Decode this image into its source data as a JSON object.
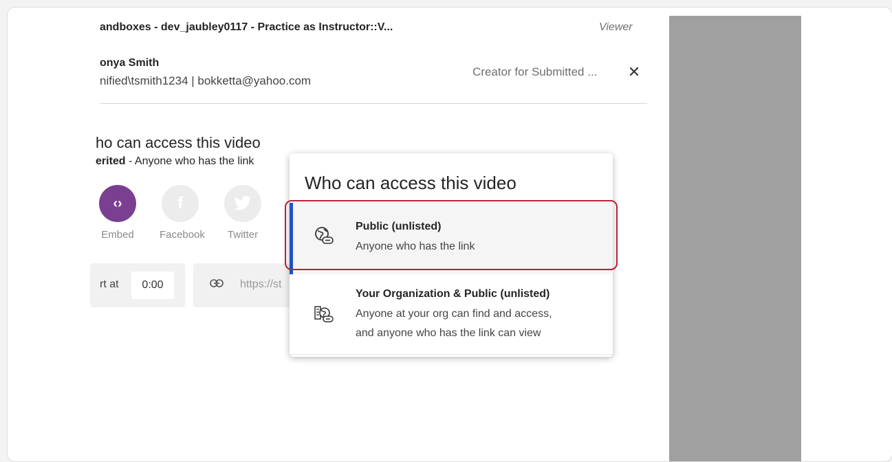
{
  "header": {
    "channel_title": "andboxes - dev_jaubley0117 - Practice as Instructor::V...",
    "role": "Viewer"
  },
  "user": {
    "name": "onya Smith",
    "details": "nified\\tsmith1234 | bokketta@yahoo.com",
    "role": "Creator for Submitted ..."
  },
  "access_section": {
    "heading": "ho can access this video",
    "status_bold": "erited",
    "status_rest": " - Anyone who has the link"
  },
  "share": {
    "items": [
      {
        "label": "Embed",
        "icon": "embed-icon"
      },
      {
        "label": "Facebook",
        "icon": "facebook-icon"
      },
      {
        "label": "Twitter",
        "icon": "twitter-icon"
      }
    ],
    "start_label": "rt at",
    "start_time": "0:00",
    "url": "https://st"
  },
  "dropdown": {
    "title": "Who can access this video",
    "options": [
      {
        "title": "Public (unlisted)",
        "description": "Anyone who has the link",
        "selected": true,
        "icon": "globe-link-icon"
      },
      {
        "title": "Your Organization & Public (unlisted)",
        "description_line1": "Anyone at your org can find and access,",
        "description_line2": "and anyone who has the link can view",
        "selected": false,
        "icon": "org-globe-link-icon"
      }
    ]
  },
  "colors": {
    "accent_purple": "#7b3f91",
    "selected_bar": "#2051c9",
    "highlight": "#b51f37"
  }
}
